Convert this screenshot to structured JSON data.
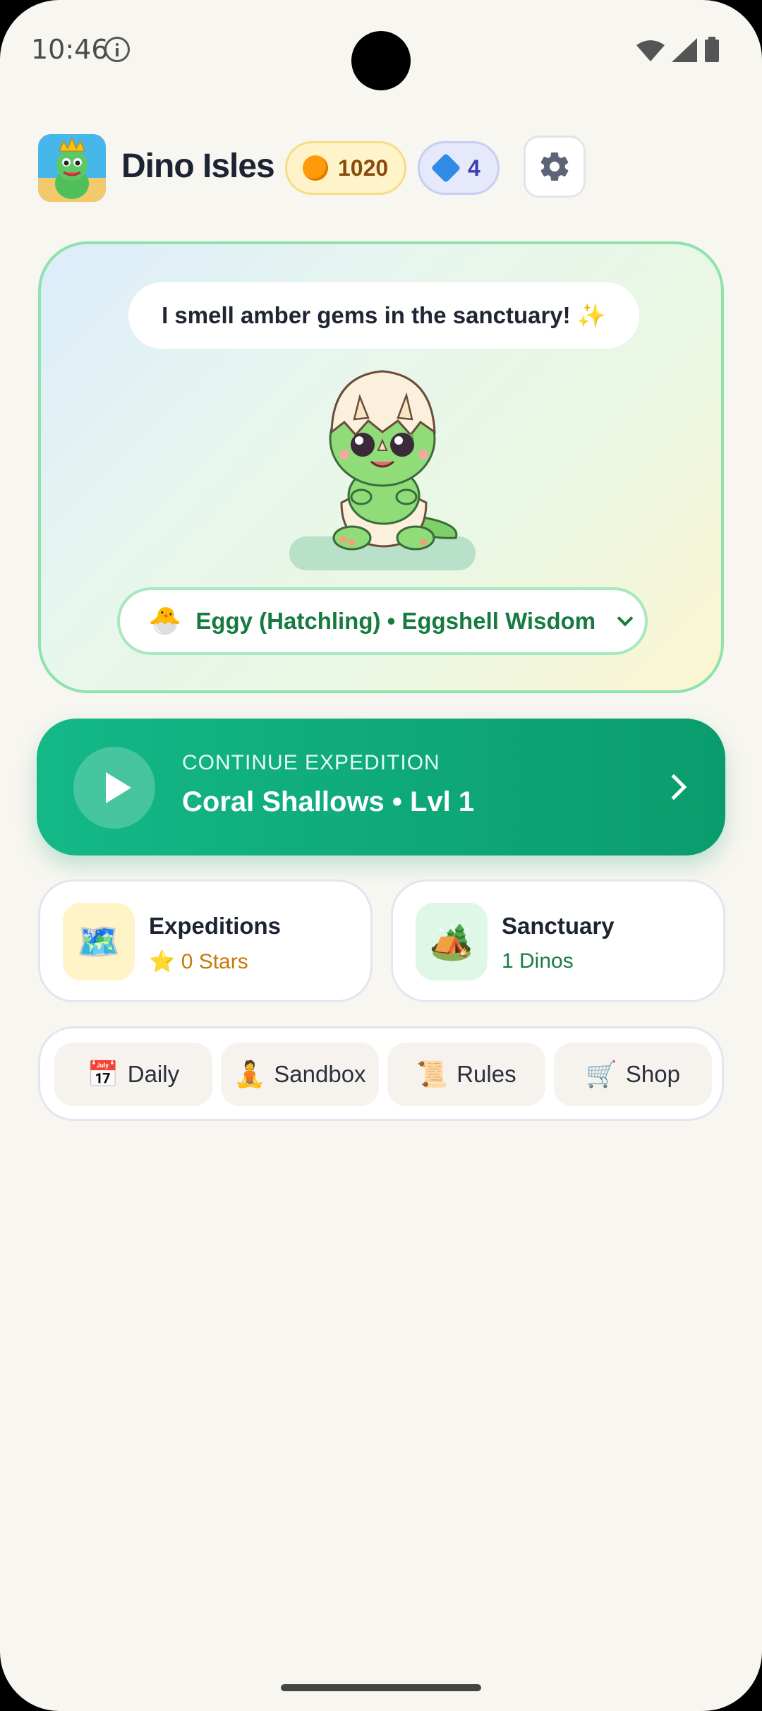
{
  "status_bar": {
    "time": "10:46"
  },
  "header": {
    "app_title": "Dino Isles",
    "coins": "1020",
    "gems": "4"
  },
  "hero": {
    "speech": "I smell amber gems in the sanctuary! ✨",
    "selector_icon": "🐣",
    "selector_label": "Eggy (Hatchling) • Eggshell Wisdom"
  },
  "continue": {
    "kicker": "CONTINUE EXPEDITION",
    "title": "Coral Shallows • Lvl 1"
  },
  "tiles": [
    {
      "icon": "🗺️",
      "title": "Expeditions",
      "sub": "⭐ 0 Stars",
      "sub_color": "#c77a0a",
      "bg": "#fff3c8"
    },
    {
      "icon": "🏕️",
      "title": "Sanctuary",
      "sub": "1 Dinos",
      "sub_color": "#1b7d43",
      "bg": "#dff7e6"
    }
  ],
  "quick": [
    {
      "icon": "📅",
      "label": "Daily"
    },
    {
      "icon": "🧘",
      "label": "Sandbox"
    },
    {
      "icon": "📜",
      "label": "Rules"
    },
    {
      "icon": "🛒",
      "label": "Shop"
    }
  ],
  "colors": {
    "accent_green": "#0fa877",
    "background": "#f8f6f1"
  }
}
